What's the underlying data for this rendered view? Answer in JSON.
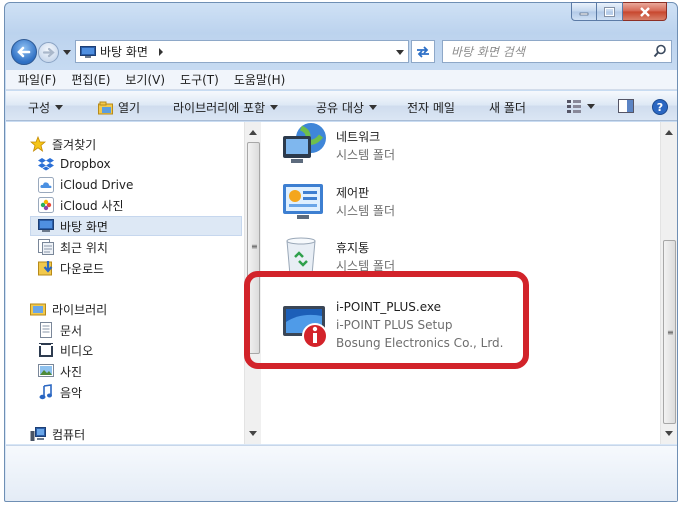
{
  "address": {
    "location": "바탕 화면"
  },
  "search": {
    "placeholder": "바탕 화면 검색"
  },
  "menu": [
    "파일(F)",
    "편집(E)",
    "보기(V)",
    "도구(T)",
    "도움말(H)"
  ],
  "toolbar": {
    "organize": "구성",
    "open": "열기",
    "include_library": "라이브러리에 포함",
    "share": "공유 대상",
    "email": "전자 메일",
    "new_folder": "새 폴더"
  },
  "nav": {
    "favorites": {
      "label": "즐겨찾기",
      "items": [
        {
          "label": "Dropbox",
          "icon": "dropbox-icon"
        },
        {
          "label": "iCloud Drive",
          "icon": "icloud-icon"
        },
        {
          "label": "iCloud 사진",
          "icon": "icloud-photos-icon"
        },
        {
          "label": "바탕 화면",
          "icon": "desktop-icon",
          "selected": true
        },
        {
          "label": "최근 위치",
          "icon": "recent-icon"
        },
        {
          "label": "다운로드",
          "icon": "download-icon"
        }
      ]
    },
    "libraries": {
      "label": "라이브러리",
      "items": [
        {
          "label": "문서",
          "icon": "documents-icon"
        },
        {
          "label": "비디오",
          "icon": "video-icon"
        },
        {
          "label": "사진",
          "icon": "pictures-icon"
        },
        {
          "label": "음악",
          "icon": "music-icon"
        }
      ]
    },
    "computer": {
      "label": "컴퓨터"
    }
  },
  "files": [
    {
      "name": "네트워크",
      "type": "시스템 폴더"
    },
    {
      "name": "제어판",
      "type": "시스템 폴더"
    },
    {
      "name": "휴지통",
      "type": "시스템 폴더"
    },
    {
      "name": "i-POINT_PLUS.exe",
      "type": "i-POINT PLUS Setup",
      "publisher": "Bosung Electronics Co., Lrd."
    }
  ],
  "colors": {
    "highlight": "#d2232a",
    "selection": "#dde8f5"
  }
}
